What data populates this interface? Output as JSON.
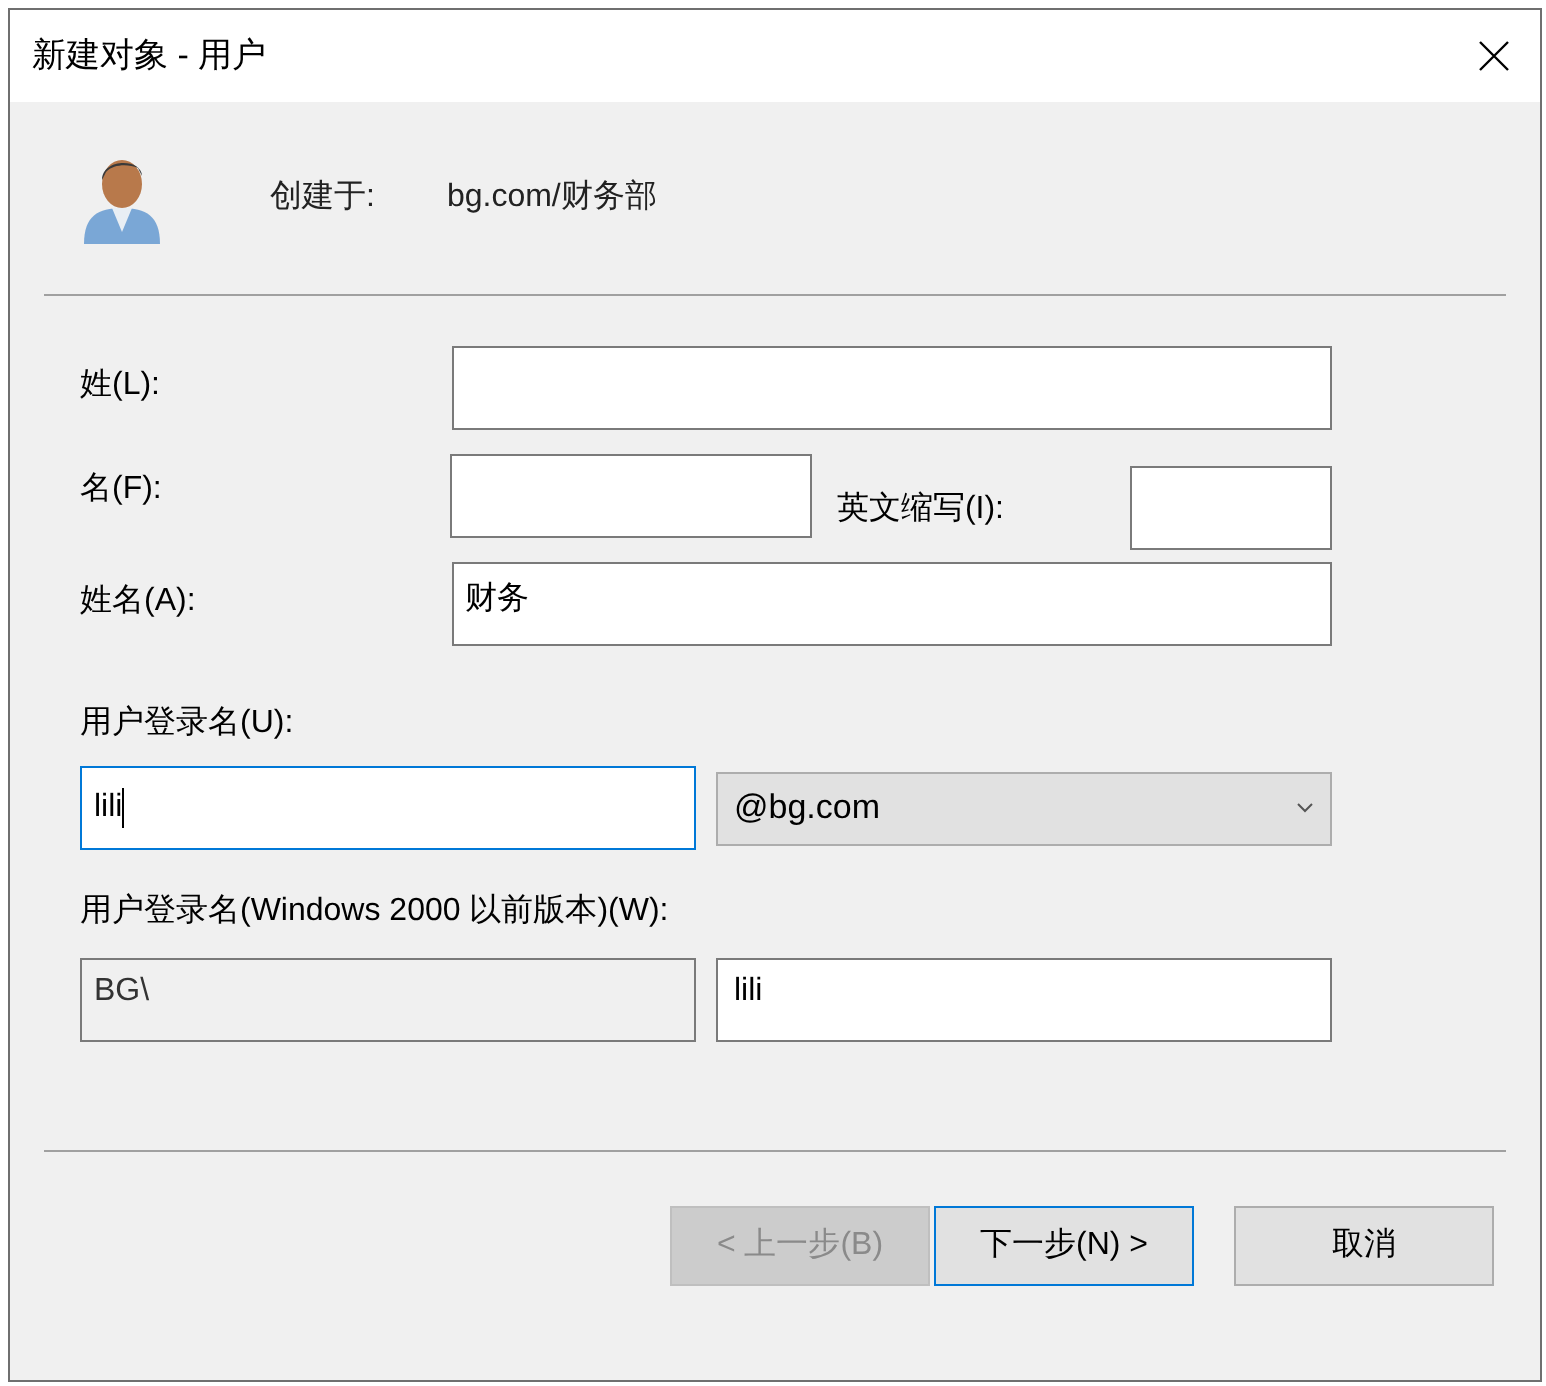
{
  "window": {
    "title": "新建对象 - 用户"
  },
  "created_in": {
    "label": "创建于:",
    "value": "bg.com/财务部"
  },
  "name_fields": {
    "last_name": {
      "label": "姓(L):"
    },
    "first_name": {
      "label": "名(F):"
    },
    "initials": {
      "label": "英文缩写(I):"
    },
    "full_name": {
      "label": "姓名(A):",
      "value": "财务"
    }
  },
  "logon_name": {
    "label": "用户登录名(U):",
    "value": "lili",
    "focused": true,
    "domain": "@bg.com"
  },
  "pre2000": {
    "label": "用户登录名(Windows 2000 以前版本)(W):",
    "prefix": "BG\\",
    "prefix_disabled": true,
    "value": "lili"
  },
  "buttons": [
    {
      "label": "< 上一步(B)",
      "disabled": true,
      "default": false
    },
    {
      "label": "下一步(N) >",
      "disabled": false,
      "default": true
    },
    {
      "label": "取消",
      "disabled": false,
      "default": false
    }
  ]
}
